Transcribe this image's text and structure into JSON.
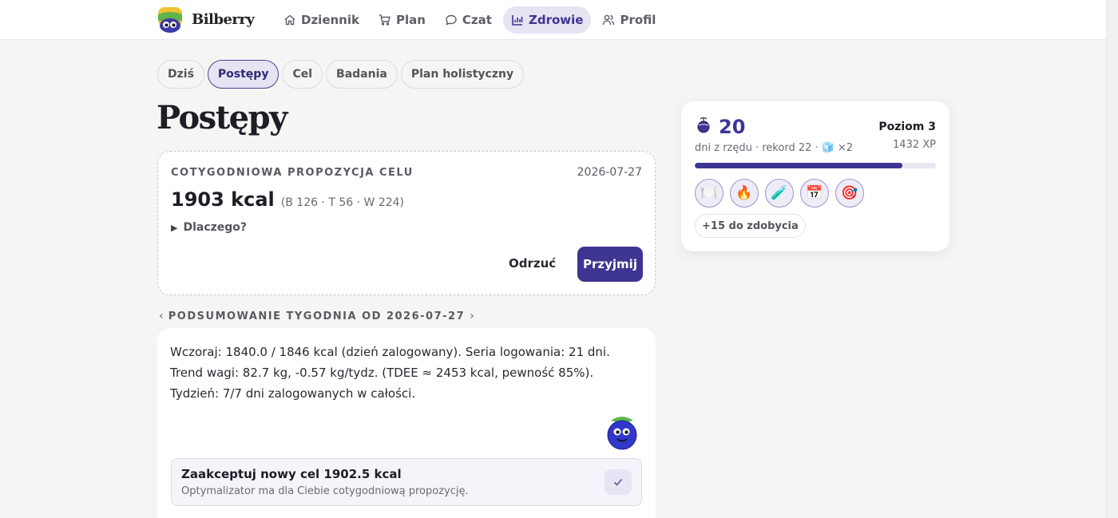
{
  "brand": {
    "name": "Bilberry"
  },
  "nav": [
    {
      "label": "Dziennik",
      "icon": "home-icon"
    },
    {
      "label": "Plan",
      "icon": "cart-icon"
    },
    {
      "label": "Czat",
      "icon": "chat-icon"
    },
    {
      "label": "Zdrowie",
      "icon": "bar-chart-icon",
      "active": true
    },
    {
      "label": "Profil",
      "icon": "users-icon"
    }
  ],
  "tabs": [
    {
      "label": "Dziś"
    },
    {
      "label": "Postępy",
      "active": true
    },
    {
      "label": "Cel"
    },
    {
      "label": "Badania"
    },
    {
      "label": "Plan holistyczny"
    }
  ],
  "page": {
    "title": "Postępy"
  },
  "proposal": {
    "kicker": "COTYGODNIOWA PROPOZYCJA CELU",
    "date": "2026-07-27",
    "kcal": "1903 kcal",
    "macros": "(B 126 · T 56 · W 224)",
    "why": "Dlaczego?",
    "reject_label": "Odrzuć",
    "accept_label": "Przyjmij"
  },
  "weekly": {
    "heading": "PODSUMOWANIE TYGODNIA OD 2026-07-27",
    "text": "Wczoraj: 1840.0 / 1846 kcal (dzień zalogowany). Seria logowania: 21 dni. Trend wagi: 82.7 kg, -0.57 kg/tydz. (TDEE ≈ 2453 kcal, pewność 85%). Tydzień: 7/7 dni zalogowanych w całości.",
    "accept_title": "Zaakceptuj nowy cel 1902.5 kcal",
    "accept_sub": "Optymalizator ma dla Ciebie cotygodniową propozycję."
  },
  "streak": {
    "days": "20",
    "sub_text": "dni z rzędu · rekord 22 ·",
    "freeze": "×2",
    "level": "Poziom 3",
    "xp": "1432 XP",
    "progress": 0.86,
    "badges": [
      {
        "icon": "plate-icon",
        "glyph": "🍽️"
      },
      {
        "icon": "fire-icon",
        "glyph": "🔥"
      },
      {
        "icon": "test-tube-icon",
        "glyph": "🧪"
      },
      {
        "icon": "calendar-icon",
        "glyph": "📅"
      },
      {
        "icon": "target-icon",
        "glyph": "🎯"
      }
    ],
    "to_earn": "+15 do zdobycia"
  },
  "colors": {
    "accent": "#3d3592",
    "accent_soft": "#e6e3f3",
    "background": "#f6f5f3"
  }
}
